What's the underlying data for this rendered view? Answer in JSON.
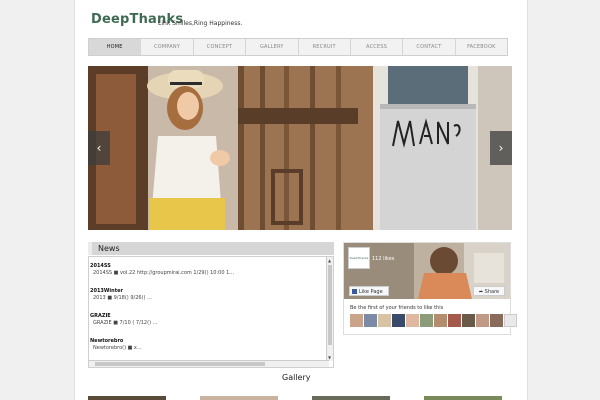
{
  "header": {
    "logo": "DeepThanks",
    "tagline": "Link Smiles,Ring Happiness."
  },
  "nav": {
    "items": [
      "HOME",
      "COMPANY",
      "CONCEPT",
      "GALLERY",
      "RECRUIT",
      "ACCESS",
      "CONTACT",
      "FACEBOOK"
    ],
    "active": "HOME"
  },
  "hero": {
    "prev_icon": "chevron-left-icon",
    "next_icon": "chevron-right-icon",
    "prev_glyph": "‹",
    "next_glyph": "›"
  },
  "news": {
    "heading": "News",
    "entries": [
      {
        "title": "2014SS",
        "text": "2014SS ■ vol.22 http://groupmirai.com 1/29() 10:00 1..."
      },
      {
        "title": "2013Winter",
        "text": "2013 ■ 9/18() 9/26() ..."
      },
      {
        "title": "GRAZIE",
        "text": "GRAZIE ■ 7/10 ( 7/12() ..."
      },
      {
        "title": "Newtorebro",
        "text": "Newtorebro() ■ x..."
      }
    ]
  },
  "facebook": {
    "page_logo": "DeepThanks",
    "likes": "112 likes",
    "like_button": "Like Page",
    "share_button": "Share",
    "friends_text": "Be the first of your friends to like this"
  },
  "gallery": {
    "title": "Gallery"
  },
  "colors": {
    "brand": "#3f6b52",
    "nav_bg": "#f2f2f2",
    "nav_active": "#d8d8d8"
  }
}
